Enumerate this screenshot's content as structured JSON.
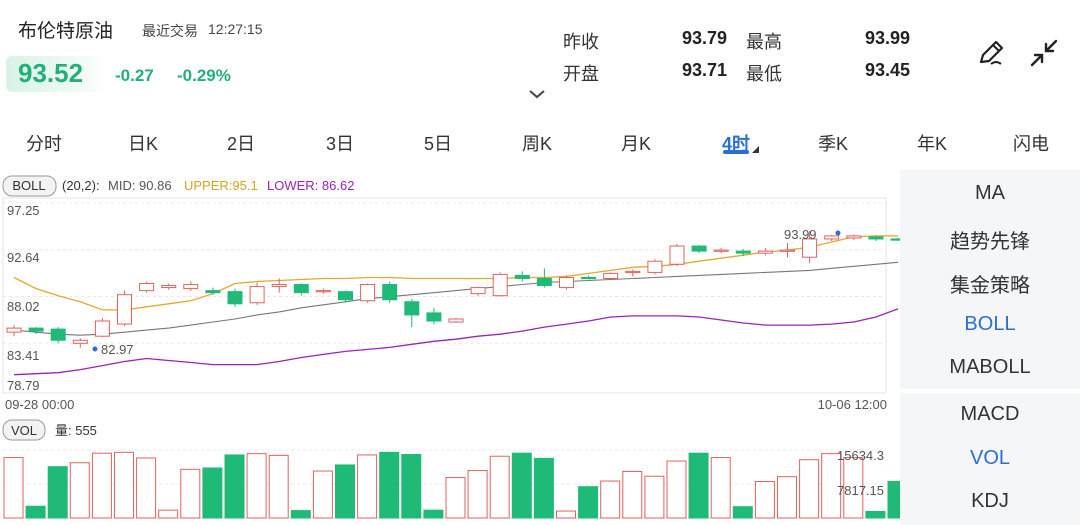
{
  "header": {
    "title": "布伦特原油",
    "last_trade_label": "最近交易",
    "last_trade_time": "12:27:15",
    "price": "93.52",
    "change": "-0.27",
    "change_pct": "-0.29%",
    "stats": [
      {
        "label": "昨收",
        "value": "93.79"
      },
      {
        "label": "最高",
        "value": "93.99"
      },
      {
        "label": "开盘",
        "value": "93.71"
      },
      {
        "label": "最低",
        "value": "93.45"
      }
    ]
  },
  "tabs": [
    "分时",
    "日K",
    "2日",
    "3日",
    "5日",
    "周K",
    "月K",
    "4时",
    "季K",
    "年K",
    "闪电"
  ],
  "active_tab": "4时",
  "side_menu": {
    "top": [
      "MA",
      "趋势先锋",
      "集金策略",
      "BOLL",
      "MABOLL"
    ],
    "bottom": [
      "MACD",
      "VOL",
      "KDJ"
    ],
    "active": [
      "BOLL",
      "VOL"
    ]
  },
  "colors": {
    "up": "#e0625f",
    "down": "#1fba78",
    "accent": "#2a6dd8",
    "mid": "#777777",
    "upper": "#e2a92e",
    "lower": "#9b22b8"
  },
  "chart_data": {
    "type": "candlestick",
    "indicator": {
      "badge": "BOLL",
      "params": "(20,2):",
      "mid_label": "MID: 90.86",
      "upper_label": "UPPER:95.1",
      "lower_label": "LOWER: 86.62"
    },
    "y_ticks": [
      "97.25",
      "92.64",
      "88.02",
      "83.41",
      "78.79"
    ],
    "ylim": [
      78.79,
      97.25
    ],
    "x_start_label": "09-28 00:00",
    "x_end_label": "10-06 12:00",
    "annotation_high": "93.99",
    "annotation_low": "82.97",
    "candles": [
      [
        84.5,
        84.9,
        84.1,
        85.2
      ],
      [
        84.9,
        84.6,
        84.3,
        85.0
      ],
      [
        84.8,
        83.7,
        83.4,
        85.0
      ],
      [
        83.4,
        83.7,
        82.97,
        83.9
      ],
      [
        84.1,
        85.6,
        84.0,
        85.9
      ],
      [
        85.3,
        88.2,
        85.1,
        88.6
      ],
      [
        88.6,
        89.3,
        88.4,
        89.5
      ],
      [
        88.9,
        89.1,
        88.7,
        89.3
      ],
      [
        88.8,
        89.2,
        88.6,
        89.5
      ],
      [
        88.6,
        88.4,
        88.2,
        88.9
      ],
      [
        88.5,
        87.3,
        87.0,
        88.8
      ],
      [
        87.4,
        89.0,
        87.2,
        89.4
      ],
      [
        89.0,
        89.2,
        88.4,
        89.8
      ],
      [
        89.2,
        88.4,
        88.1,
        89.3
      ],
      [
        88.5,
        88.6,
        88.3,
        88.8
      ],
      [
        88.5,
        87.7,
        87.5,
        88.6
      ],
      [
        87.6,
        89.2,
        87.4,
        89.3
      ],
      [
        89.2,
        87.7,
        87.4,
        89.5
      ],
      [
        87.5,
        86.2,
        85.0,
        87.8
      ],
      [
        86.4,
        85.6,
        85.3,
        86.9
      ],
      [
        85.5,
        85.8,
        85.4,
        85.9
      ],
      [
        88.3,
        88.9,
        88.1,
        89.0
      ],
      [
        88.1,
        90.2,
        88.0,
        90.4
      ],
      [
        90.1,
        89.8,
        89.5,
        90.5
      ],
      [
        89.8,
        89.1,
        88.9,
        90.8
      ],
      [
        88.9,
        89.9,
        88.7,
        90.1
      ],
      [
        89.9,
        89.8,
        89.7,
        90.1
      ],
      [
        89.8,
        90.3,
        89.7,
        90.4
      ],
      [
        90.4,
        90.5,
        90.0,
        90.7
      ],
      [
        90.4,
        91.5,
        90.2,
        91.7
      ],
      [
        91.2,
        93.0,
        91.0,
        93.2
      ],
      [
        93.0,
        92.5,
        92.3,
        93.1
      ],
      [
        92.5,
        92.6,
        92.3,
        92.8
      ],
      [
        92.5,
        92.3,
        92.0,
        92.7
      ],
      [
        92.3,
        92.5,
        92.1,
        92.8
      ],
      [
        92.6,
        92.6,
        91.9,
        93.3
      ],
      [
        91.9,
        93.7,
        91.3,
        94.5
      ],
      [
        93.7,
        94.0,
        93.5,
        94.1
      ],
      [
        93.8,
        94.0,
        93.6,
        94.1
      ],
      [
        93.9,
        93.7,
        93.5,
        93.99
      ],
      [
        93.7,
        93.6,
        93.5,
        93.8
      ]
    ],
    "mid": [
      84.7,
      84.5,
      84.3,
      84.2,
      84.3,
      84.5,
      84.7,
      84.9,
      85.2,
      85.5,
      85.8,
      86.2,
      86.5,
      86.9,
      87.2,
      87.5,
      87.8,
      88.0,
      88.2,
      88.4,
      88.6,
      88.8,
      89.0,
      89.2,
      89.4,
      89.5,
      89.6,
      89.7,
      89.8,
      89.9,
      90.0,
      90.1,
      90.2,
      90.3,
      90.4,
      90.5,
      90.6,
      90.8,
      91.0,
      91.2,
      91.4
    ],
    "upper": [
      89.9,
      88.8,
      88.1,
      87.5,
      86.7,
      86.7,
      87.0,
      87.3,
      87.6,
      88.3,
      89.3,
      89.5,
      89.6,
      89.7,
      89.8,
      89.8,
      89.9,
      89.9,
      89.8,
      89.8,
      89.8,
      89.8,
      89.8,
      89.9,
      89.9,
      90.0,
      90.3,
      90.6,
      90.9,
      91.0,
      91.2,
      91.5,
      91.8,
      92.1,
      92.4,
      92.6,
      92.9,
      93.4,
      93.9,
      94.0,
      94.0
    ],
    "lower": [
      80.3,
      80.4,
      80.5,
      80.8,
      81.2,
      81.6,
      81.9,
      81.7,
      81.5,
      81.3,
      81.3,
      81.3,
      81.6,
      82.0,
      82.3,
      82.6,
      82.8,
      83.0,
      83.3,
      83.6,
      83.8,
      84.1,
      84.3,
      84.6,
      85.0,
      85.3,
      85.6,
      86.0,
      86.1,
      86.1,
      86.1,
      86.0,
      85.7,
      85.4,
      85.2,
      85.2,
      85.2,
      85.3,
      85.5,
      86.0,
      86.8
    ],
    "volume": {
      "badge": "VOL",
      "label": "量: 555",
      "tick_max": "15634.3",
      "tick_mid": "7817.15",
      "max": 15634.3,
      "values": [
        13900,
        2700,
        11800,
        12700,
        14900,
        15100,
        13800,
        1800,
        11200,
        11500,
        14500,
        14800,
        14400,
        1700,
        10800,
        12200,
        14500,
        15100,
        14600,
        1800,
        9300,
        10900,
        14200,
        14900,
        13700,
        1600,
        7200,
        8500,
        10700,
        9600,
        13100,
        14900,
        13900,
        2600,
        8400,
        9500,
        13400,
        14800,
        13900,
        1500,
        8400,
        555
      ]
    }
  }
}
